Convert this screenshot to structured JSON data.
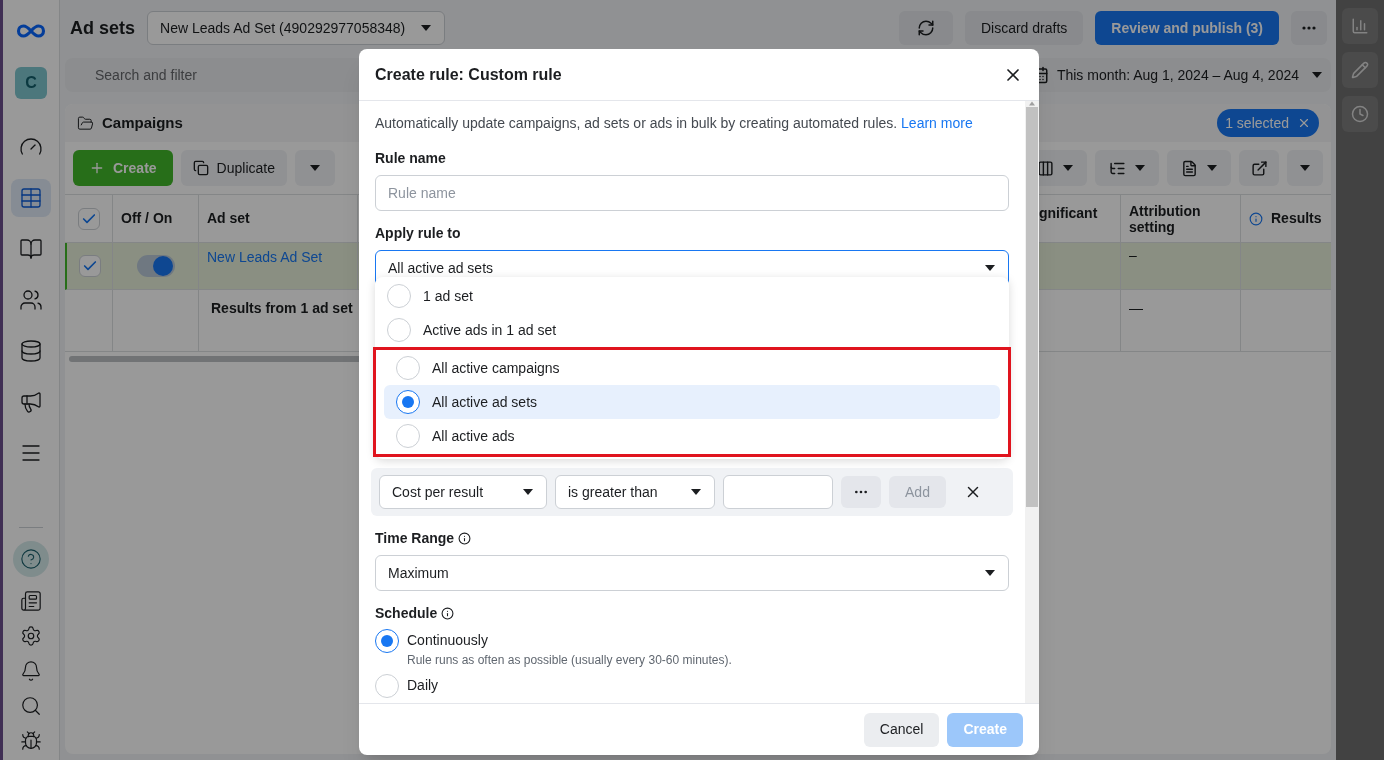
{
  "nav": {
    "avatar": "C",
    "items": [
      {
        "kind": "gauge",
        "selected": false
      },
      {
        "kind": "table",
        "selected": true
      },
      {
        "kind": "book",
        "selected": false
      },
      {
        "kind": "people",
        "selected": false
      },
      {
        "kind": "coins",
        "selected": false
      },
      {
        "kind": "megaphone",
        "selected": false
      },
      {
        "kind": "menu",
        "selected": false
      }
    ]
  },
  "header": {
    "title": "Ad sets",
    "selector": "New Leads Ad Set (490292977058348)",
    "discard": "Discard drafts",
    "publish": "Review and publish (3)"
  },
  "filter": {
    "placeholder": "Search and filter",
    "date_range": "This month: Aug 1, 2024 – Aug 4, 2024"
  },
  "panel": {
    "title": "Campaigns",
    "selection_badge": "1 selected"
  },
  "toolbar": {
    "create": "Create",
    "duplicate": "Duplicate"
  },
  "table": {
    "header_checked": true,
    "columns": [
      "Off / On",
      "Ad set",
      "gnificant",
      "Attribution setting",
      "Results"
    ],
    "rows": [
      {
        "checked": true,
        "on": true,
        "ad_set": "New Leads Ad Set",
        "attribution": "–"
      }
    ],
    "summary": {
      "label": "Results from 1 ad set",
      "attribution": "—"
    }
  },
  "modal": {
    "title": "Create rule: Custom rule",
    "intro": "Automatically update campaigns, ad sets or ads in bulk by creating automated rules.",
    "learn_more": "Learn more",
    "rule_name": {
      "label": "Rule name",
      "placeholder": "Rule name"
    },
    "apply_to": {
      "label": "Apply rule to",
      "value": "All active ad sets",
      "expanded": true,
      "options": [
        {
          "label": "1 ad set",
          "selected": false,
          "highlighted": false
        },
        {
          "label": "Active ads in 1 ad set",
          "selected": false,
          "highlighted": false
        },
        {
          "label": "All active campaigns",
          "selected": false,
          "highlighted": true
        },
        {
          "label": "All active ad sets",
          "selected": true,
          "highlighted": true
        },
        {
          "label": "All active ads",
          "selected": false,
          "highlighted": true
        }
      ]
    },
    "condition": {
      "metric": "Cost per result",
      "operator": "is greater than",
      "add": "Add"
    },
    "time_range": {
      "label": "Time Range",
      "value": "Maximum"
    },
    "schedule": {
      "label": "Schedule",
      "options": [
        {
          "label": "Continuously",
          "description": "Rule runs as often as possible (usually every 30-60 minutes).",
          "selected": true
        },
        {
          "label": "Daily",
          "selected": false
        }
      ]
    },
    "buttons": {
      "cancel": "Cancel",
      "create": "Create",
      "create_disabled": true
    }
  }
}
